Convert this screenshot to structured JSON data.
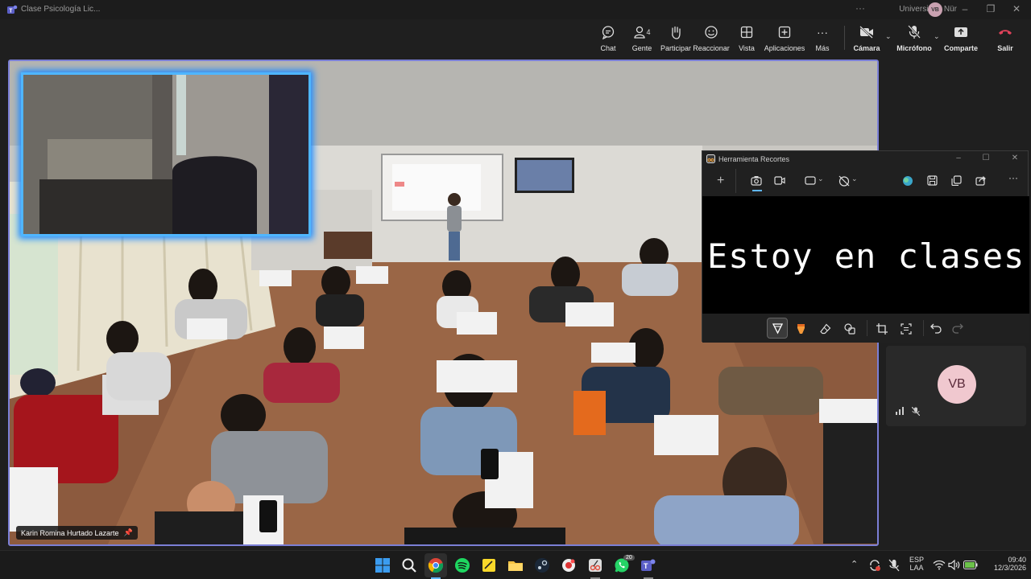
{
  "window": {
    "title": "Clase Psicología Lic...",
    "org": "Universidad Nür",
    "user_initials_small": "VB"
  },
  "toolbar": {
    "chat": "Chat",
    "people": "Gente",
    "people_count": "4",
    "raise": "Participar",
    "react": "Reaccionar",
    "view": "Vista",
    "apps": "Aplicaciones",
    "more": "Más",
    "camera": "Cámara",
    "mic": "Micrófono",
    "share": "Comparte",
    "leave": "Salir"
  },
  "main_video": {
    "participant_name": "Karin Romina Hurtado Lazarte"
  },
  "participant": {
    "initials": "VB"
  },
  "snipping_tool": {
    "title": "Herramienta Recortes",
    "canvas_text": "Estoy en clases"
  },
  "taskbar": {
    "lang_top": "ESP",
    "lang_bottom": "LAA",
    "time": "09:40",
    "date": "12/3/2026",
    "whatsapp_badge": "20"
  },
  "colors": {
    "accent": "#7b7fd6",
    "self_border": "#4fb6ff",
    "leave": "#e0425a",
    "avatar_bg": "#f0c8cf"
  }
}
